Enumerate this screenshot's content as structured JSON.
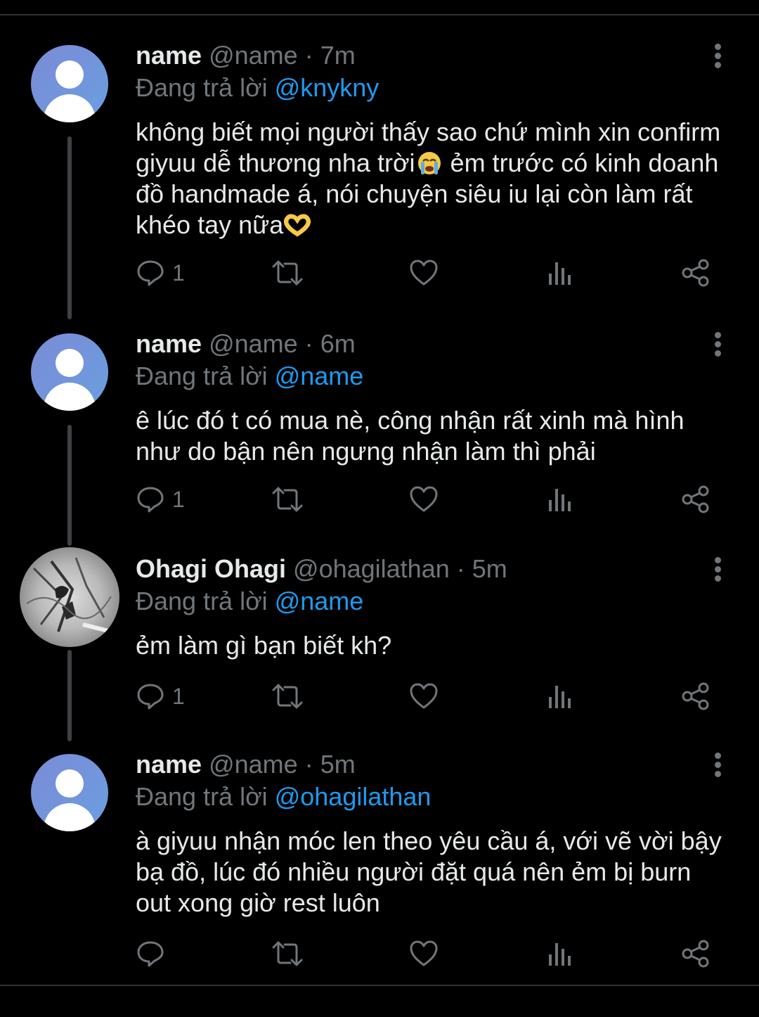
{
  "tweets": [
    {
      "name": "name",
      "handle": "@name",
      "separator": "·",
      "time": "7m",
      "reply_prefix": "Đang trả lời",
      "reply_to": "@knykny",
      "text": "không biết mọi người thấy sao chứ mình xin confirm giyuu dễ thương nha trời",
      "text_after_emoji": " ẻm trước có kinh doanh đồ handmade á, nói chuyện siêu iu lại còn làm rất khéo tay nữa",
      "emoji1": "loudly-crying-face",
      "emoji2": "heart-hands",
      "reply_count": "1",
      "avatar": "default-profile"
    },
    {
      "name": "name",
      "handle": "@name",
      "separator": "·",
      "time": "6m",
      "reply_prefix": "Đang trả lời",
      "reply_to": "@name",
      "text": "ê lúc đó t có mua nè, công nhận rất xinh mà hình như do bận nên ngưng nhận làm thì phải",
      "reply_count": "1",
      "avatar": "default-profile"
    },
    {
      "name": "Ohagi Ohagi",
      "handle": "@ohagilathan",
      "separator": "·",
      "time": "5m",
      "reply_prefix": "Đang trả lời",
      "reply_to": "@name",
      "text": "ẻm làm gì bạn biết kh?",
      "reply_count": "1",
      "avatar": "manga-art"
    },
    {
      "name": "name",
      "handle": "@name",
      "separator": "·",
      "time": "5m",
      "reply_prefix": "Đang trả lời",
      "reply_to": "@ohagilathan",
      "text": "à giyuu nhận móc len theo yêu cầu á, với vẽ vời bậy bạ đồ, lúc đó nhiều người đặt quá nên ẻm bị burn out xong giờ rest luôn",
      "reply_count": "",
      "avatar": "default-profile"
    }
  ],
  "colors": {
    "background": "#000000",
    "text_primary": "#e7e9ea",
    "text_secondary": "#71767b",
    "mention": "#1d9bf0",
    "divider": "#2f3336"
  },
  "icons": [
    "reply-icon",
    "retweet-icon",
    "like-icon",
    "views-icon",
    "share-icon",
    "more-icon"
  ]
}
